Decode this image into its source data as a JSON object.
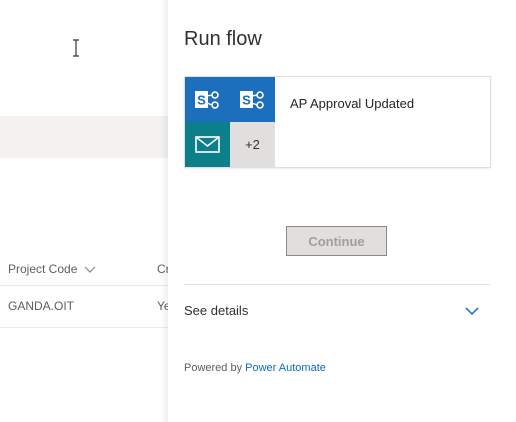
{
  "background_page": {
    "columns": [
      {
        "label": "Project Code"
      },
      {
        "label": "Cr"
      }
    ],
    "rows": [
      {
        "project_code": "GANDA.OIT",
        "created": "Ye"
      }
    ]
  },
  "run_flow": {
    "title": "Run flow",
    "flow": {
      "name": "AP Approval Updated",
      "connectors": [
        "sharepoint-icon",
        "sharepoint-icon",
        "mail-icon"
      ],
      "more_count": "+2"
    },
    "continue_label": "Continue",
    "continue_enabled": false,
    "see_details_label": "See details",
    "powered_by_prefix": "Powered by",
    "powered_by_link": "Power Automate"
  },
  "colors": {
    "sharepoint_tile": "#1c6fbd",
    "mail_tile": "#0b7f8a",
    "link": "#0f6cbd",
    "chevron": "#0f6cbd"
  }
}
